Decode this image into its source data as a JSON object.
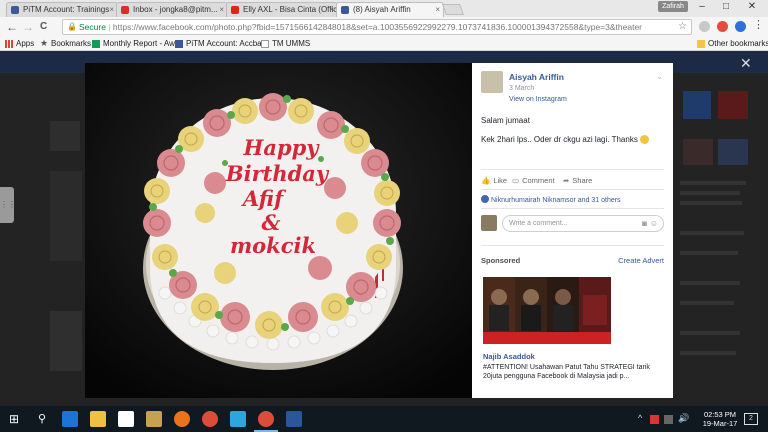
{
  "browser": {
    "tabs": [
      {
        "label": "PiTM Account: Trainings",
        "color": "#3b5998"
      },
      {
        "label": "Inbox - jongka8@pitm...",
        "color": "#d93025"
      },
      {
        "label": "Elly AXL - Bisa Cinta (Official...",
        "color": "#e62117"
      },
      {
        "label": "(8) Aisyah Ariffin",
        "color": "#3b5998"
      }
    ],
    "tab_close": "×",
    "profile": "Zafirah",
    "window_controls": [
      "–",
      "□",
      "✕"
    ],
    "nav": {
      "back": "←",
      "forward": "→",
      "reload": "C"
    },
    "address": {
      "secure_label": "Secure",
      "url": "https://www.facebook.com/photo.php?fbid=1571566142848018&set=a.1003556922992279.1073741836.100001394372558&type=3&theater"
    },
    "bookmarks": [
      {
        "label": "Apps",
        "icon": "apps-grid-icon"
      },
      {
        "label": "Bookmarks",
        "icon": "star-icon"
      },
      {
        "label": "Monthly Report - Awa",
        "icon": "sheets-icon"
      },
      {
        "label": "PiTM Account: Accba",
        "icon": "pitm-icon"
      },
      {
        "label": "TM UMMS",
        "icon": "page-icon"
      }
    ],
    "other_bookmarks": "Other bookmarks"
  },
  "post": {
    "author": "Aisyah Ariffin",
    "date": "3 March",
    "via": "View on Instagram",
    "line1": "Salam jumaat",
    "line2": "Kek 2hari lps.. Oder dr ckgu azi lagi. Thanks",
    "actions": {
      "like": "Like",
      "comment": "Comment",
      "share": "Share"
    },
    "likes": "Niknurhumairah Niknamsor and 31 others",
    "comment_placeholder": "Write a comment...",
    "sponsored": "Sponsored",
    "create_ad": "Create Advert",
    "ad_name": "Najib Asaddok",
    "ad_text": "#ATTENTION! Usahawan Patut Tahu STRATEGI tarik 20juta pengguna Facebook di Malaysia jadi p...",
    "close": "✕"
  },
  "cake_text": {
    "line1": "Happy",
    "line2": "Birthday",
    "line3": "Afif",
    "line4": "&",
    "line5": "mokcik"
  },
  "taskbar": {
    "time": "02:53 PM",
    "date": "19-Mar-17",
    "notification_count": "2"
  }
}
